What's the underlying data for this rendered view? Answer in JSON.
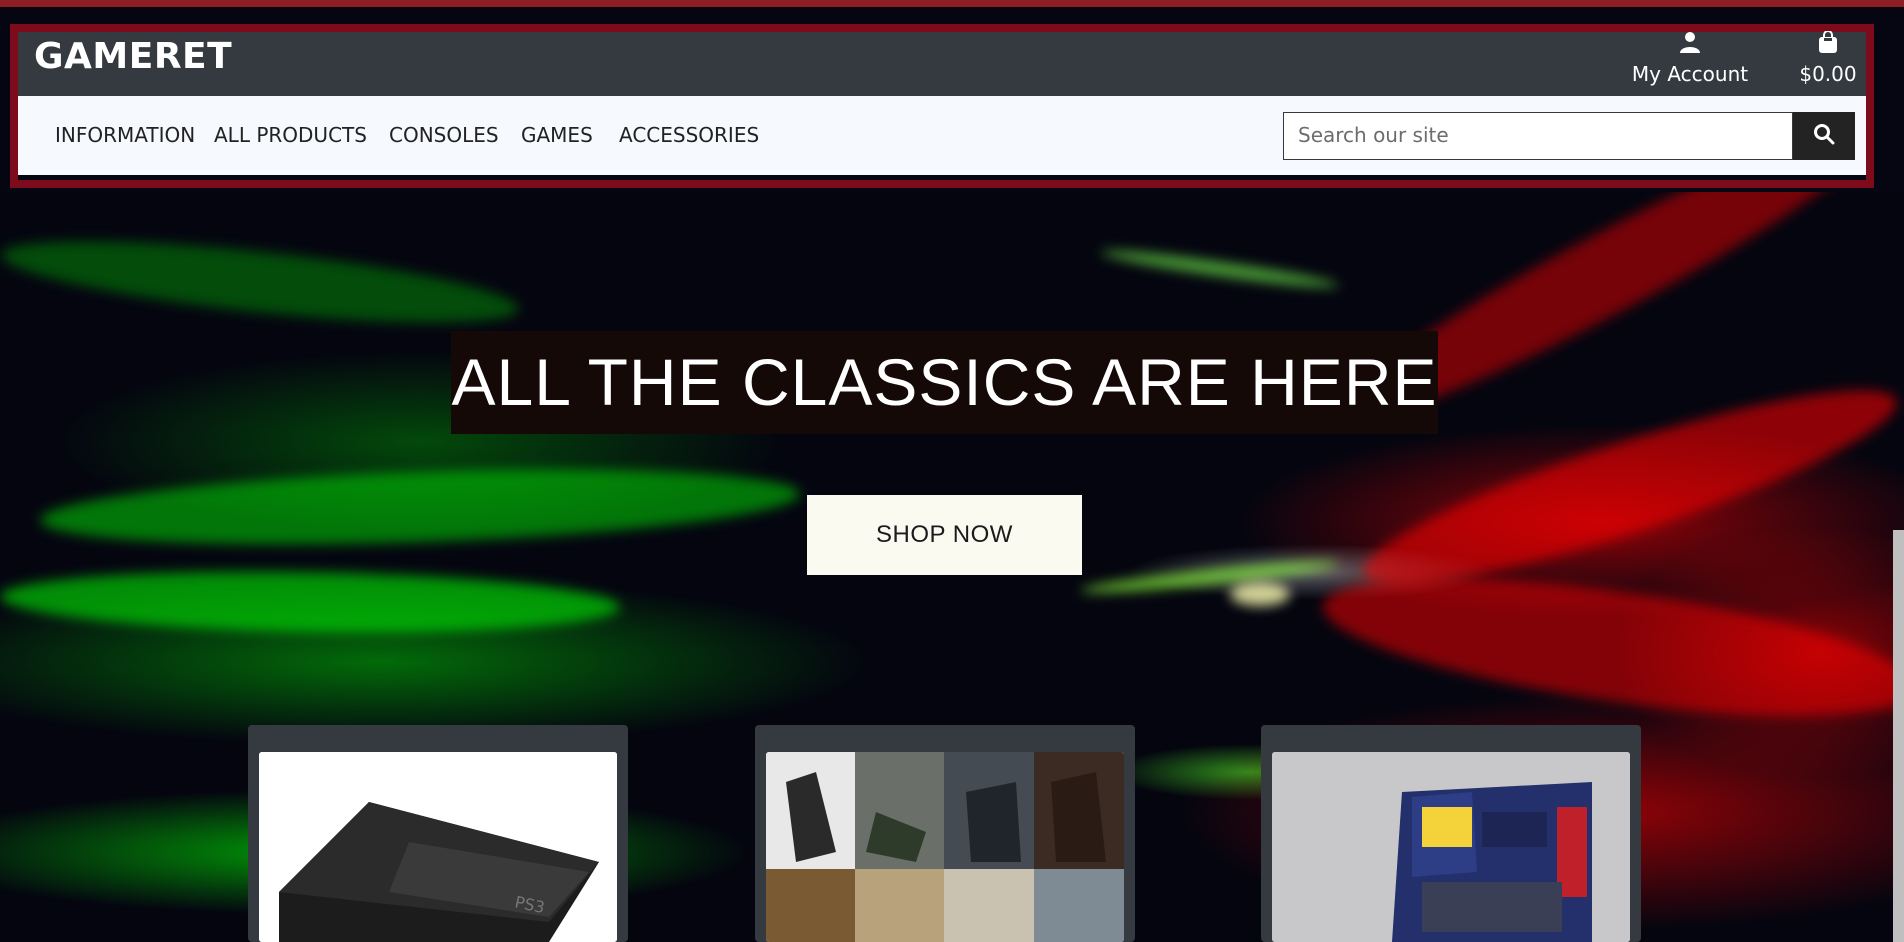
{
  "header": {
    "brand": "GAMERET",
    "account_label": "My Account",
    "account_icon": "user-icon",
    "cart_label": "$0.00",
    "cart_icon": "shopping-bag-icon"
  },
  "nav": {
    "items": [
      {
        "label": "INFORMATION"
      },
      {
        "label": "ALL PRODUCTS"
      },
      {
        "label": "CONSOLES"
      },
      {
        "label": "GAMES"
      },
      {
        "label": "ACCESSORIES"
      }
    ]
  },
  "search": {
    "placeholder": "Search our site",
    "value": "",
    "button_icon": "search-icon"
  },
  "hero": {
    "headline": "ALL THE CLASSICS ARE HERE",
    "cta_label": "SHOP NOW"
  },
  "cards": [
    {
      "image": "console-product-image"
    },
    {
      "image": "game-covers-collage-image"
    },
    {
      "image": "retro-game-box-image"
    }
  ],
  "colors": {
    "header_frame": "#7d0b1c",
    "header_dark": "#343a40",
    "nav_background": "#f6f9fd",
    "cta_background": "#fbfaf0"
  }
}
